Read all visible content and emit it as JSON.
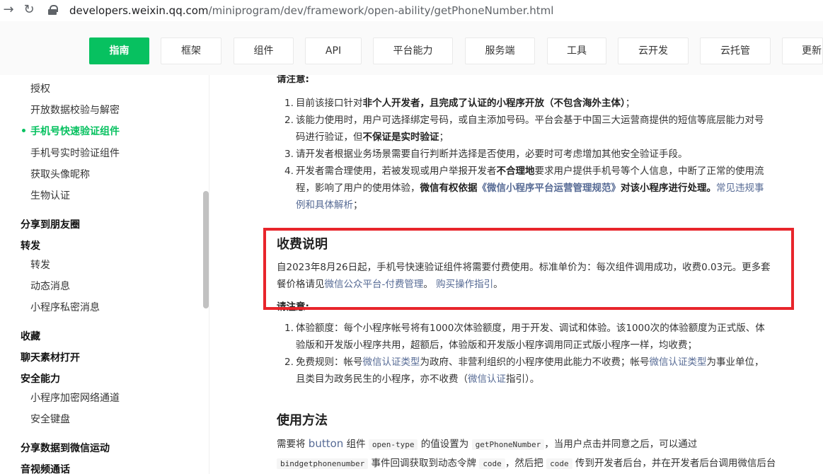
{
  "browser": {
    "url_host": "developers.weixin.qq.com",
    "url_path": "/miniprogram/dev/framework/open-ability/getPhoneNumber.html"
  },
  "tabs": [
    "指南",
    "框架",
    "组件",
    "API",
    "平台能力",
    "服务端",
    "工具",
    "云开发",
    "云托管",
    "更新"
  ],
  "sidebar": {
    "items": [
      {
        "label": "授权",
        "kind": "sub"
      },
      {
        "label": "开放数据校验与解密",
        "kind": "sub"
      },
      {
        "label": "手机号快速验证组件",
        "kind": "sub",
        "active": true
      },
      {
        "label": "手机号实时验证组件",
        "kind": "sub"
      },
      {
        "label": "获取头像昵称",
        "kind": "sub"
      },
      {
        "label": "生物认证",
        "kind": "sub"
      },
      {
        "label": "分享到朋友圈",
        "kind": "group"
      },
      {
        "label": "转发",
        "kind": "group"
      },
      {
        "label": "转发",
        "kind": "sub"
      },
      {
        "label": "动态消息",
        "kind": "sub"
      },
      {
        "label": "小程序私密消息",
        "kind": "sub"
      },
      {
        "label": "收藏",
        "kind": "group"
      },
      {
        "label": "聊天素材打开",
        "kind": "group"
      },
      {
        "label": "安全能力",
        "kind": "group"
      },
      {
        "label": "小程序加密网络通道",
        "kind": "sub"
      },
      {
        "label": "安全键盘",
        "kind": "sub"
      },
      {
        "label": "分享数据到微信运动",
        "kind": "group"
      },
      {
        "label": "音视频通话",
        "kind": "group"
      }
    ]
  },
  "content": {
    "notice_title_top": "请注意:",
    "notice_items": {
      "i1_pre": "目前该接口针对",
      "i1_bold": "非个人开发者，且完成了认证的小程序开放（不包含海外主体）",
      "i1_post": "；",
      "i2_line1": "该能力使用时，用户可选择绑定号码，或自主添加号码。平台会基于中国三大运营商提供的短信等底层能力对号",
      "i2_line2_pre": "码进行验证，但",
      "i2_line2_bold": "不保证是实时验证",
      "i2_line2_post": "；",
      "i3": "请开发者根据业务场景需要自行判断并选择是否使用，必要时可考虑增加其他安全验证手段。",
      "i4_line1_pre": "开发者需合理使用，若被发现或用户举报开发者",
      "i4_line1_bold": "不合理地",
      "i4_line1_post": "要求用户提供手机号等个人信息，中断了正常的使用流",
      "i4_line2_pre": "程，影响了用户的使用体验，",
      "i4_line2_bold1": "微信有权依据",
      "i4_line2_link": "《微信小程序平台运营管理规范》",
      "i4_line2_bold2": "对该小程序进行处理。",
      "i4_line2_link2": "常见违规事",
      "i4_line3_link": "例和具体解析",
      "i4_line3_post": "；"
    },
    "fee_title": "收费说明",
    "fee_line1": "自2023年8月26日起，手机号快速验证组件将需要付费使用。标准单价为：每次组件调用成功，收费0.03元。更多套",
    "fee_line2_pre": "餐价格请见",
    "fee_link1": "微信公众平台-付费管理",
    "fee_line2_mid": "。",
    "fee_link2": "购买操作指引",
    "fee_line2_post": "。",
    "notice_title_2": "请注意:",
    "fee_items": {
      "f1_line1": "体验额度：每个小程序帐号将有1000次体验额度，用于开发、调试和体验。该1000次的体验额度为正式版、体",
      "f1_line2": "验版和开发版小程序共用，超额后，体验版和开发版小程序调用同正式版小程序一样，均收费；",
      "f2_line1_pre": "免费规则：帐号",
      "f2_link1": "微信认证类型",
      "f2_line1_mid": "为政府、非营利组织的小程序使用此能力不收费；帐号",
      "f2_link2": "微信认证类型",
      "f2_line1_post": "为事业单位，",
      "f2_line2_pre": "且类目为政务民生的小程序，亦不收费（",
      "f2_link3": "微信认证",
      "f2_line2_post": "指引）。"
    },
    "usage_title": "使用方法",
    "usage_line1_pre": "需要将",
    "usage_button_link": "button",
    "usage_line1_a": "组件",
    "usage_code1": "open-type",
    "usage_line1_b": "的值设置为",
    "usage_code2": "getPhoneNumber",
    "usage_line1_c": "，当用户点击并同意之后，可以通过",
    "usage_code3": "bindgetphonenumber",
    "usage_line2_a": "事件回调获取到动态令牌",
    "usage_code4": "code",
    "usage_line2_b": "，然后把",
    "usage_code5": "code",
    "usage_line2_c": "传到开发者后台，并在开发者后台调用微信后台"
  },
  "colors": {
    "brand_green": "#07c160",
    "link": "#576b95",
    "highlight_red": "#e8252b"
  }
}
